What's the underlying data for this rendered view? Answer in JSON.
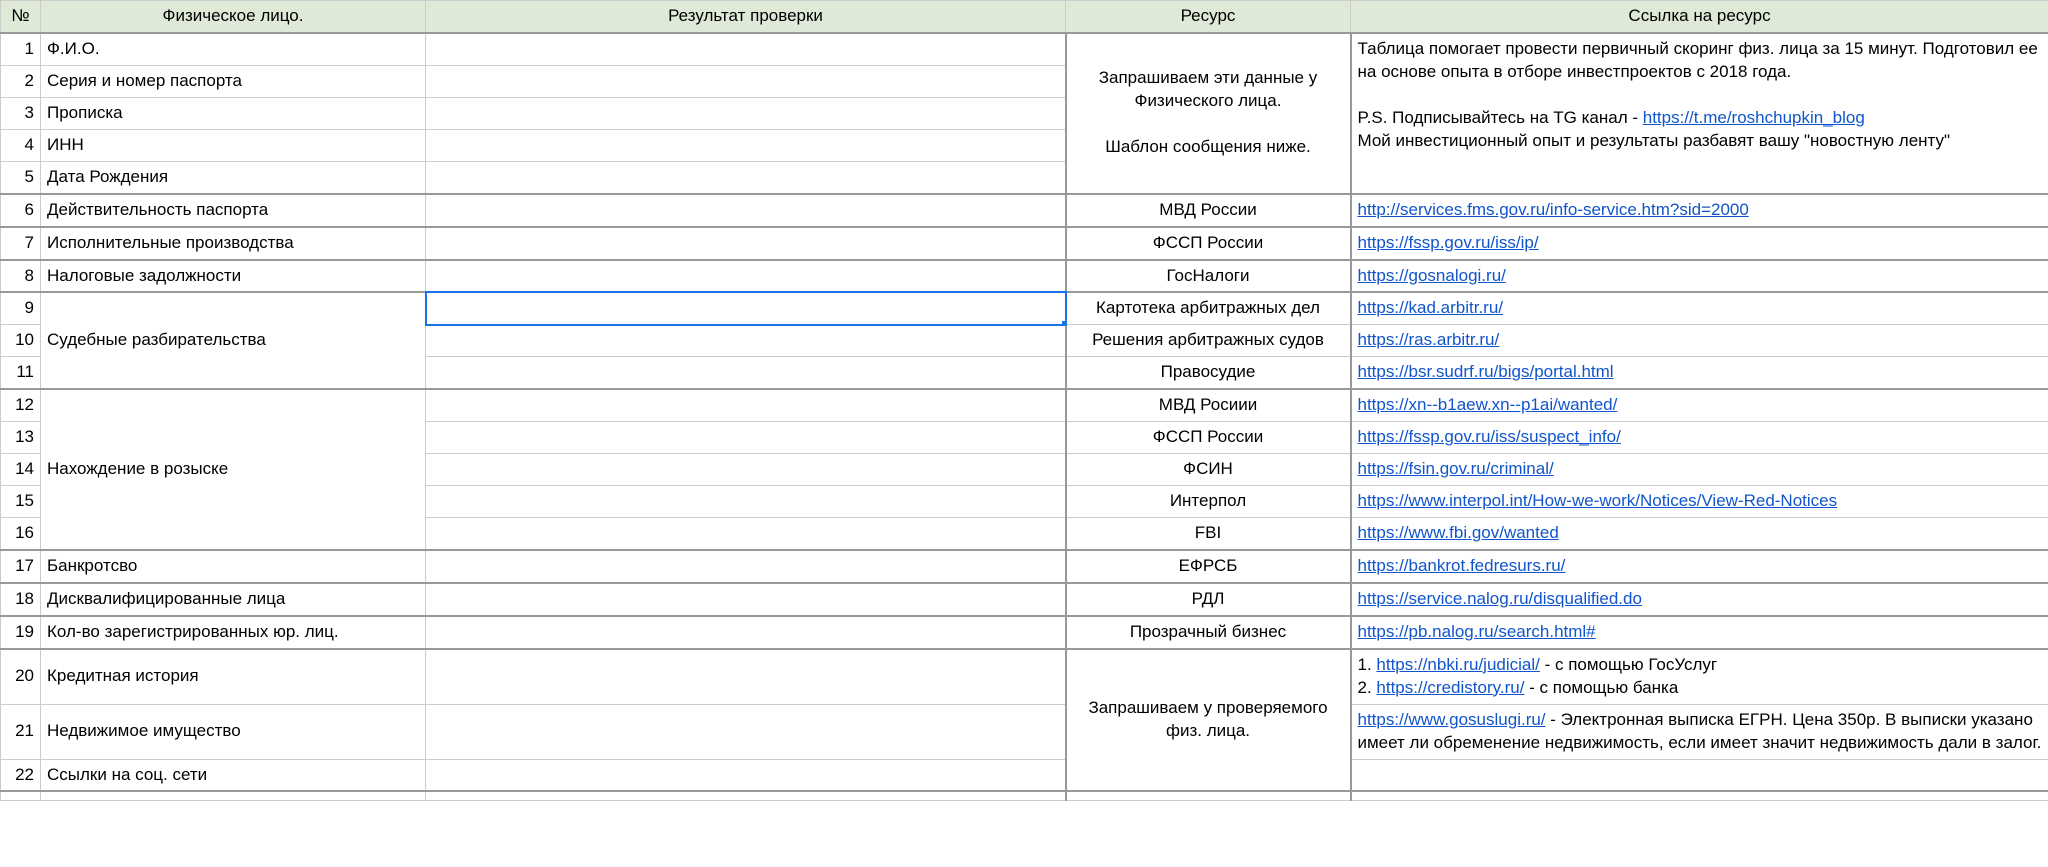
{
  "headers": {
    "num": "№",
    "c1": "Физическое лицо.",
    "c2": "Результат проверки",
    "c3": "Ресурс",
    "c4": "Ссылка на ресурс"
  },
  "group1_resource": "Запрашиваем эти данные у Физического лица.\n\nШаблон сообщения ниже.",
  "intro_before": "Таблица помогает провести первичный скоринг физ. лица за 15 минут. Подготовил ее на основе опыта в отборе инвестпроектов с 2018 года.\n\nP.S. Подписывайтесь на TG канал - ",
  "intro_link": "https://t.me/roshchupkin_blog",
  "intro_after": "\nМой инвестиционный опыт и результаты разбавят вашу \"новостную ленту\"",
  "rows": {
    "1": {
      "c1": "Ф.И.О."
    },
    "2": {
      "c1": "Серия и номер паспорта"
    },
    "3": {
      "c1": "Прописка"
    },
    "4": {
      "c1": "ИНН"
    },
    "5": {
      "c1": "Дата Рождения"
    },
    "6": {
      "c1": "Действительность паспорта",
      "c3": "МВД России",
      "link": "http://services.fms.gov.ru/info-service.htm?sid=2000"
    },
    "7": {
      "c1": "Исполнительные производства",
      "c3": "ФССП России",
      "link": "https://fssp.gov.ru/iss/ip/"
    },
    "8": {
      "c1": "Налоговые задолжности",
      "c3": "ГосНалоги",
      "link": "https://gosnalogi.ru/"
    },
    "9": {
      "c3": "Картотека арбитражных дел",
      "link": "https://kad.arbitr.ru/"
    },
    "10": {
      "c1": "Судебные разбирательства",
      "c3": "Решения арбитражных судов",
      "link": "https://ras.arbitr.ru/"
    },
    "11": {
      "c3": "Правосудие",
      "link": "https://bsr.sudrf.ru/bigs/portal.html"
    },
    "12": {
      "c3": "МВД Росиии",
      "link": "https://xn--b1aew.xn--p1ai/wanted/"
    },
    "13": {
      "c3": "ФССП России",
      "link": "https://fssp.gov.ru/iss/suspect_info/"
    },
    "14": {
      "c1": "Нахождение в розыске",
      "c3": "ФСИН",
      "link": "https://fsin.gov.ru/criminal/"
    },
    "15": {
      "c3": "Интерпол",
      "link": "https://www.interpol.int/How-we-work/Notices/View-Red-Notices"
    },
    "16": {
      "c3": "FBI",
      "link": "https://www.fbi.gov/wanted"
    },
    "17": {
      "c1": "Банкротсво",
      "c3": "ЕФРСБ",
      "link": "https://bankrot.fedresurs.ru/"
    },
    "18": {
      "c1": "Дисквалифицированные лица",
      "c3": "РДЛ",
      "link": "https://service.nalog.ru/disqualified.do"
    },
    "19": {
      "c1": "Кол-во зарегистрированных юр. лиц.",
      "c3": "Прозрачный бизнес",
      "link": "https://pb.nalog.ru/search.html#"
    },
    "20": {
      "c1": "Кредитная история"
    },
    "21": {
      "c1": "Недвижимое имущество"
    },
    "22": {
      "c1": "Ссылки на соц. сети"
    }
  },
  "group20_resource": "Запрашиваем у проверяемого физ. лица.",
  "credit": {
    "p1": "1. ",
    "link1": "https://nbki.ru/judicial/",
    "t1": "  - с помощью ГосУслуг",
    "p2": "2. ",
    "link2": "https://credistory.ru/",
    "t2": " - с помощью банка"
  },
  "realestate": {
    "link": "https://www.gosuslugi.ru/",
    "text": "  - Электронная выписка ЕГРН. Цена 350р. В выписки указано имеет ли обременение недвижимость, если имеет значит недвижимость дали в залог."
  }
}
